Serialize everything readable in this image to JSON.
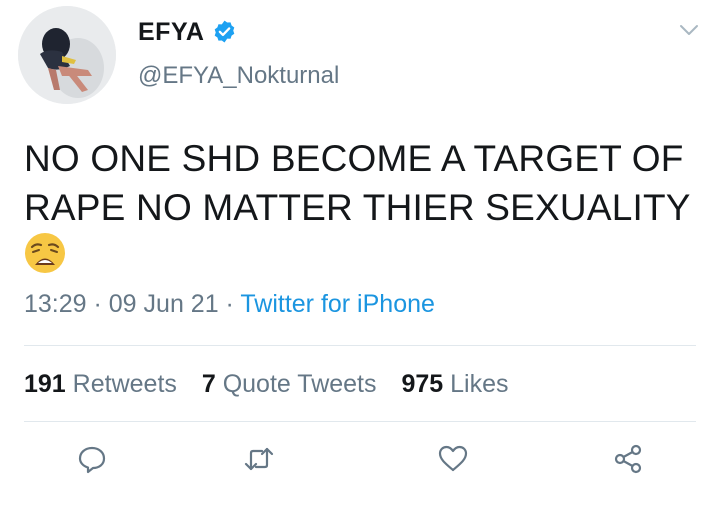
{
  "author": {
    "display_name": "EFYA",
    "handle": "@EFYA_Nokturnal",
    "verified": true
  },
  "tweet": {
    "text": "NO ONE SHD BECOME A TARGET OF RAPE NO MATTER THIER SEXUALITY",
    "emoji": "weary-face-emoji"
  },
  "meta": {
    "time": "13:29",
    "sep1": " · ",
    "date": "09 Jun 21",
    "sep2": " · ",
    "source": "Twitter for iPhone"
  },
  "stats": {
    "retweets_count": "191",
    "retweets_label": "Retweets",
    "quotes_count": "7",
    "quotes_label": "Quote Tweets",
    "likes_count": "975",
    "likes_label": "Likes"
  },
  "actions": {
    "reply_icon": "reply-icon",
    "retweet_icon": "retweet-icon",
    "like_icon": "like-icon",
    "share_icon": "share-icon"
  },
  "colors": {
    "text": "#14171a",
    "secondary": "#657786",
    "accent": "#1b95e0",
    "divider": "#e1e8ed"
  }
}
